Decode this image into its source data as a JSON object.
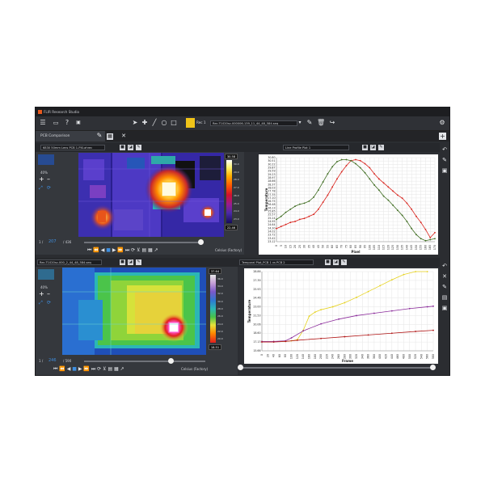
{
  "window": {
    "title": "FLIR Research Studio"
  },
  "toolbar": {
    "file_index": "Rec 1",
    "file_name": "Rec-T1020sc-000006-139_11_44_48_584.seq"
  },
  "tab": {
    "label": "PCB Comparison"
  },
  "top_left": {
    "selector": "6830 50mm Lens PCB 1-PXI.ahrec",
    "zoom": "40%",
    "frame_prefix": "1 /",
    "frame_current": "207",
    "frame_total": "/ 436",
    "unit": "Celsius (Factory)",
    "scale_max": "30.58",
    "scale_min": "22.46",
    "scale_ticks": [
      "30.0",
      "29.0",
      "28.0",
      "27.0",
      "26.0",
      "25.0",
      "24.0",
      "23.0"
    ]
  },
  "top_right": {
    "selector": "Line Profile Plot 1",
    "xlabel": "Pixel",
    "ylabel": "Temperature",
    "yticks": [
      "30.80",
      "30.51",
      "30.22",
      "29.87",
      "29.59",
      "29.23",
      "28.97",
      "28.66",
      "28.37",
      "28.03",
      "27.78",
      "27.35",
      "27.10",
      "26.75",
      "26.48",
      "26.13",
      "25.85",
      "25.57",
      "25.24",
      "24.95",
      "24.64",
      "24.30",
      "24.02",
      "23.72",
      "23.42",
      "23.12"
    ],
    "xticks": [
      "0",
      "5",
      "10",
      "15",
      "20",
      "25",
      "30",
      "35",
      "40",
      "45",
      "50",
      "55",
      "60",
      "65",
      "70",
      "75",
      "80",
      "85",
      "90",
      "95",
      "100",
      "105",
      "110",
      "115",
      "120",
      "125",
      "130",
      "135",
      "140",
      "145",
      "150",
      "155",
      "160",
      "165",
      "170"
    ]
  },
  "bottom_left": {
    "selector": "Rec-T1020sc-000_2_44_48_584.seq",
    "zoom": "40%",
    "frame_prefix": "1 /",
    "frame_current": "246",
    "frame_total": "/ 590",
    "unit": "Celsius (Factory)",
    "scale_max": "37.64",
    "scale_min": "18.51",
    "scale_ticks": [
      "36.0",
      "34.0",
      "32.0",
      "30.0",
      "28.0",
      "26.0",
      "24.0",
      "22.0",
      "20.0"
    ]
  },
  "bottom_right": {
    "selector": "Temporal Plot_PCB 1 vs PCB 2",
    "xlabel": "Frame",
    "ylabel": "Temperature",
    "yticks": [
      "28.86",
      "27.39",
      "25.93",
      "24.46",
      "23.00",
      "21.53",
      "20.06",
      "18.60",
      "17.13",
      "15.66"
    ],
    "xticks": [
      "0",
      "20",
      "40",
      "60",
      "80",
      "100",
      "120",
      "140",
      "160",
      "180",
      "200",
      "220",
      "240",
      "260",
      "280",
      "300",
      "320",
      "340",
      "360",
      "380",
      "400",
      "420",
      "440",
      "460",
      "480",
      "500",
      "520",
      "540",
      "560",
      "580"
    ]
  },
  "icons": {
    "menu": "☰",
    "open": "▭",
    "help": "?",
    "settings": "⚙",
    "close": "✕",
    "refresh": "↻",
    "add": "+",
    "edit": "✎"
  },
  "chart_data": [
    {
      "type": "line",
      "xlabel": "Pixel",
      "ylabel": "Temperature",
      "xlim": [
        0,
        170
      ],
      "ylim": [
        22.7,
        31.0
      ],
      "series": [
        {
          "color": "#d8231c",
          "x": [
            0,
            5,
            10,
            15,
            20,
            25,
            30,
            35,
            40,
            45,
            50,
            55,
            60,
            65,
            70,
            75,
            80,
            85,
            90,
            95,
            100,
            105,
            110,
            115,
            120,
            125,
            130,
            135,
            140,
            145,
            150,
            155,
            160,
            165,
            170
          ],
          "values": [
            24.0,
            24.2,
            24.4,
            24.6,
            24.7,
            24.9,
            25.0,
            25.2,
            25.4,
            25.9,
            26.6,
            27.3,
            28.1,
            28.9,
            29.6,
            30.2,
            30.7,
            30.8,
            30.7,
            30.4,
            30.0,
            29.4,
            28.9,
            28.5,
            28.1,
            27.7,
            27.3,
            27.0,
            26.5,
            25.9,
            25.2,
            24.6,
            23.9,
            23.1,
            23.6
          ]
        },
        {
          "color": "#3d6b1f",
          "x": [
            0,
            5,
            10,
            15,
            20,
            25,
            30,
            35,
            40,
            45,
            50,
            55,
            60,
            65,
            70,
            75,
            80,
            85,
            90,
            95,
            100,
            105,
            110,
            115,
            120,
            125,
            130,
            135,
            140,
            145,
            150,
            155,
            160,
            165,
            170
          ],
          "values": [
            24.9,
            25.2,
            25.6,
            25.9,
            26.2,
            26.4,
            26.5,
            26.7,
            27.1,
            27.8,
            28.6,
            29.4,
            30.1,
            30.6,
            30.8,
            30.8,
            30.7,
            30.4,
            30.0,
            29.5,
            28.9,
            28.3,
            27.8,
            27.2,
            26.8,
            26.3,
            25.8,
            25.3,
            24.7,
            24.0,
            23.4,
            23.0,
            22.8,
            22.9,
            23.0
          ]
        }
      ]
    },
    {
      "type": "line",
      "xlabel": "Frame",
      "ylabel": "Temperature",
      "xlim": [
        0,
        580
      ],
      "ylim": [
        15.5,
        29.0
      ],
      "series": [
        {
          "color": "#e6d21e",
          "x": [
            0,
            40,
            80,
            100,
            120,
            140,
            160,
            180,
            200,
            240,
            280,
            320,
            360,
            400,
            440,
            480,
            520,
            560
          ],
          "values": [
            17.1,
            17.1,
            17.1,
            17.2,
            17.4,
            19.0,
            21.4,
            22.1,
            22.5,
            23.0,
            23.7,
            24.6,
            25.6,
            26.6,
            27.6,
            28.5,
            29.5,
            30.4
          ]
        },
        {
          "color": "#8a2a9a",
          "x": [
            0,
            40,
            80,
            100,
            140,
            200,
            260,
            320,
            380,
            440,
            500,
            560,
            580
          ],
          "values": [
            17.1,
            17.1,
            17.2,
            17.7,
            18.9,
            20.1,
            20.9,
            21.5,
            21.9,
            22.3,
            22.7,
            23.0,
            23.1
          ]
        },
        {
          "color": "#b01414",
          "x": [
            0,
            40,
            80,
            120,
            200,
            280,
            360,
            440,
            520,
            580
          ],
          "values": [
            17.0,
            17.0,
            17.1,
            17.3,
            17.6,
            17.9,
            18.2,
            18.5,
            18.8,
            19.0
          ]
        }
      ]
    }
  ]
}
